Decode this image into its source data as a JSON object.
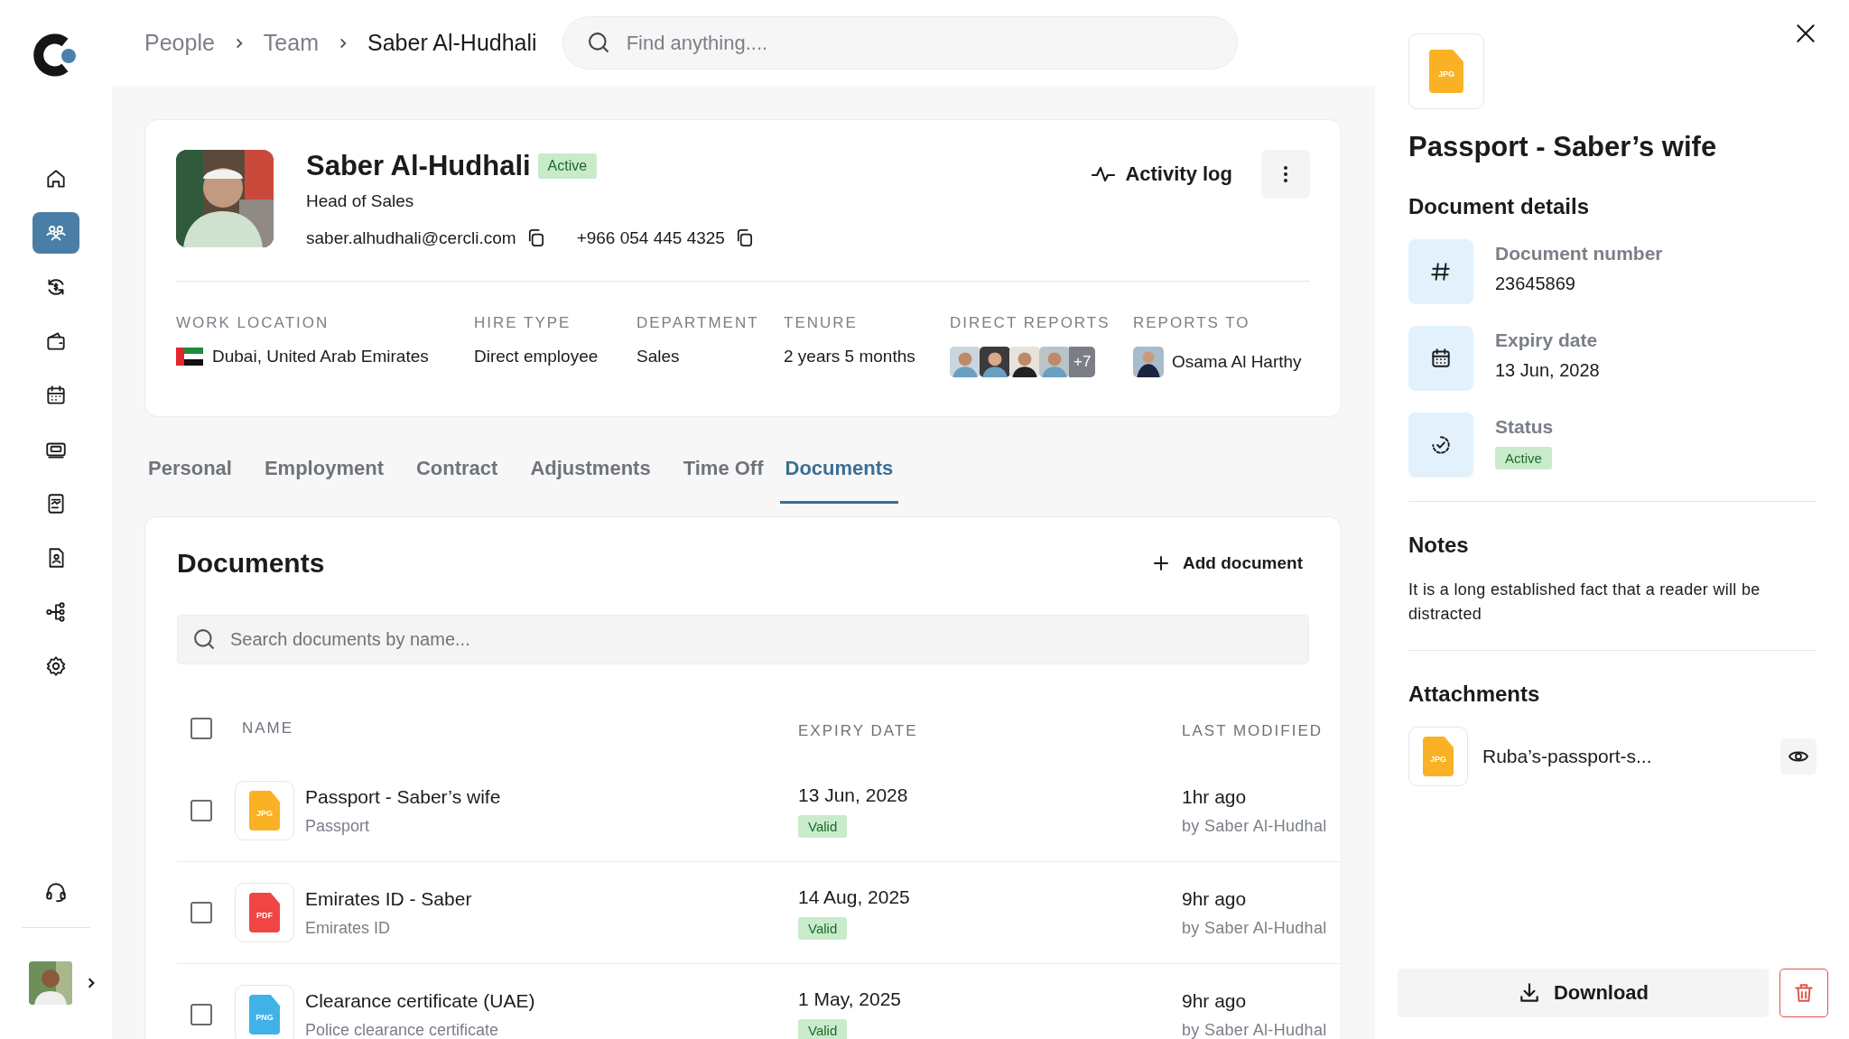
{
  "sidebar": {
    "items": [
      {
        "selected": false
      },
      {
        "selected": true
      },
      {
        "selected": false
      },
      {
        "selected": false
      },
      {
        "selected": false
      },
      {
        "selected": false
      },
      {
        "selected": false
      },
      {
        "selected": false
      },
      {
        "selected": false
      },
      {
        "selected": false
      }
    ]
  },
  "breadcrumb": [
    "People",
    "Team",
    "Saber Al-Hudhali"
  ],
  "search": {
    "placeholder": "Find anything...."
  },
  "profile": {
    "name": "Saber Al-Hudhali",
    "status": "Active",
    "title": "Head of Sales",
    "email": "saber.alhudhali@cercli.com",
    "phone": "+966 054 445 4325",
    "activity": "Activity log",
    "details": [
      {
        "label": "WORK LOCATION",
        "value": "Dubai, United Arab Emirates",
        "kind": "flag"
      },
      {
        "label": "HIRE TYPE",
        "value": "Direct employee",
        "kind": "text"
      },
      {
        "label": "DEPARTMENT",
        "value": "Sales",
        "kind": "text"
      },
      {
        "label": "TENURE",
        "value": "2 years 5 months",
        "kind": "text"
      },
      {
        "label": "DIRECT REPORTS",
        "value": "+7",
        "kind": "avatars"
      },
      {
        "label": "REPORTS TO",
        "value": "Osama Al Harthy",
        "kind": "person"
      }
    ]
  },
  "tabs": [
    {
      "label": "Personal",
      "selected": false
    },
    {
      "label": "Employment",
      "selected": false
    },
    {
      "label": "Contract",
      "selected": false
    },
    {
      "label": "Adjustments",
      "selected": false
    },
    {
      "label": "Time Off",
      "selected": false
    },
    {
      "label": "Documents",
      "selected": true
    }
  ],
  "documents": {
    "title": "Documents",
    "add": "Add document",
    "search": {
      "placeholder": "Search documents by name..."
    },
    "all_checked": false,
    "columns": [
      "NAME",
      "EXPIRY DATE",
      "LAST MODIFIED"
    ],
    "rows": [
      {
        "checked": false,
        "file_type": "JPG",
        "color": "#fbb124",
        "name": "Passport - Saber’s wife",
        "type": "Passport",
        "expiry": "13 Jun, 2028",
        "status": "Valid",
        "modified": "1hr ago",
        "by": "by Saber Al-Hudhal"
      },
      {
        "checked": false,
        "file_type": "PDF",
        "color": "#f04545",
        "name": "Emirates ID - Saber",
        "type": "Emirates ID",
        "expiry": "14 Aug, 2025",
        "status": "Valid",
        "modified": "9hr ago",
        "by": "by Saber Al-Hudhal"
      },
      {
        "checked": false,
        "file_type": "PNG",
        "color": "#40b2e8",
        "name": "Clearance certificate (UAE)",
        "type": "Police clearance certificate",
        "expiry": "1 May, 2025",
        "status": "Valid",
        "modified": "9hr ago",
        "by": "by Saber Al-Hudhal"
      }
    ]
  },
  "panel": {
    "file_type": "JPG",
    "color": "#fbb124",
    "title": "Passport - Saber’s wife",
    "details_title": "Document details",
    "details": [
      {
        "kind": "number",
        "label": "Document number",
        "value": "23645869"
      },
      {
        "kind": "date",
        "label": "Expiry date",
        "value": "13 Jun, 2028"
      },
      {
        "kind": "status",
        "label": "Status",
        "value": "Active"
      }
    ],
    "notes_title": "Notes",
    "notes": "It is a long established fact that a reader will be distracted",
    "attachments_title": "Attachments",
    "attachments": [
      {
        "file_type": "JPG",
        "color": "#fbb124",
        "name": "Ruba’s-passport-s..."
      }
    ],
    "download": "Download"
  }
}
